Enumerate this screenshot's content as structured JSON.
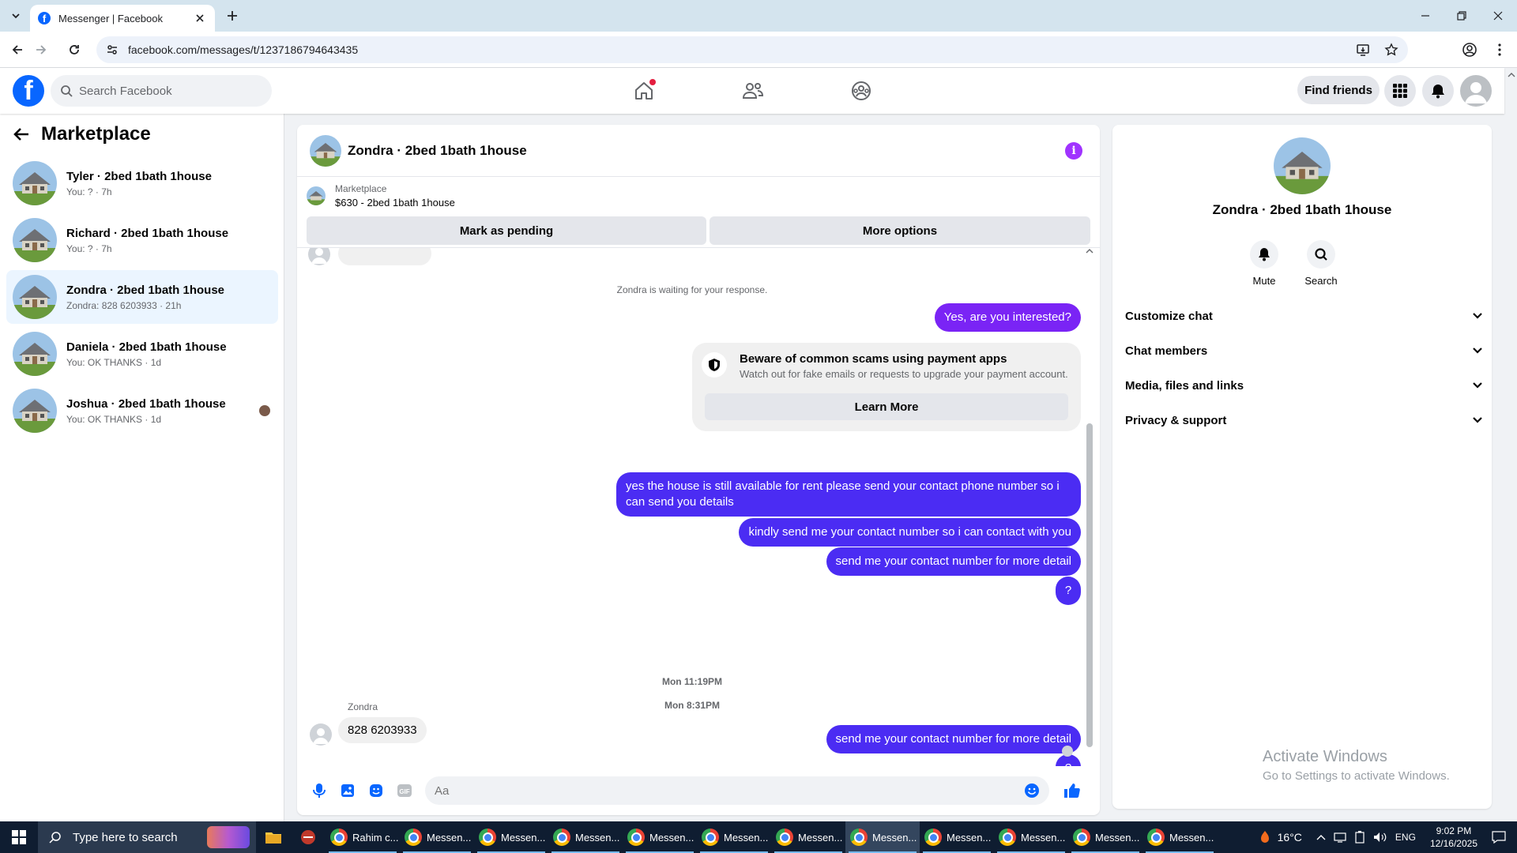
{
  "browser": {
    "tab_title": "Messenger | Facebook",
    "url": "facebook.com/messages/t/1237186794643435"
  },
  "fb": {
    "search_placeholder": "Search Facebook",
    "find_friends": "Find friends"
  },
  "sidebar": {
    "title": "Marketplace",
    "conversations": [
      {
        "name": "Tyler · 2bed 1bath 1house",
        "preview": "You: ? · 7h"
      },
      {
        "name": "Richard · 2bed 1bath 1house",
        "preview": "You: ? · 7h"
      },
      {
        "name": "Zondra · 2bed 1bath 1house",
        "preview": "Zondra: 828 6203933 · 21h",
        "active": true
      },
      {
        "name": "Daniela · 2bed 1bath 1house",
        "preview": "You: OK THANKS · 1d"
      },
      {
        "name": "Joshua · 2bed 1bath 1house",
        "preview": "You: OK THANKS · 1d"
      }
    ]
  },
  "chat": {
    "title": "Zondra · 2bed 1bath 1house",
    "marketplace_label": "Marketplace",
    "listing": "$630 - 2bed 1bath 1house",
    "mark_pending": "Mark as pending",
    "more_options": "More options",
    "waiting": "Zondra is waiting for your response.",
    "messages": [
      "Yes, are you interested?",
      "yes the house is still available for rent please send your contact phone number so i can send you details",
      "kindly send me your contact number so i can contact with you",
      "send me your contact number for more detail",
      "?",
      "send me your contact number for more detail",
      "?"
    ],
    "scam_title": "Beware of common scams using payment apps",
    "scam_body": "Watch out for fake emails or requests to upgrade your payment account.",
    "learn_more": "Learn More",
    "stamp1": "Mon 8:31PM",
    "stamp2": "Mon 11:19PM",
    "sender": "Zondra",
    "incoming": "828 6203933",
    "input_placeholder": "Aa"
  },
  "info_panel": {
    "name": "Zondra · 2bed 1bath 1house",
    "mute": "Mute",
    "search": "Search",
    "sections": [
      "Customize chat",
      "Chat members",
      "Media, files and links",
      "Privacy & support"
    ]
  },
  "watermark": {
    "line1": "Activate Windows",
    "line2": "Go to Settings to activate Windows."
  },
  "taskbar": {
    "search": "Type here to search",
    "apps": [
      "Rahim c...",
      "Messen...",
      "Messen...",
      "Messen...",
      "Messen...",
      "Messen...",
      "Messen...",
      "Messen...",
      "Messen...",
      "Messen...",
      "Messen...",
      "Messen..."
    ],
    "temp": "16°C",
    "lang": "ENG",
    "time": "9:02 PM",
    "date": "12/16/2025"
  },
  "colors": {
    "fb_blue": "#0866ff",
    "outgoing_purple": "#7a24f5",
    "outgoing_blue": "#4b2cf3",
    "active_conv": "#ebf5ff"
  }
}
